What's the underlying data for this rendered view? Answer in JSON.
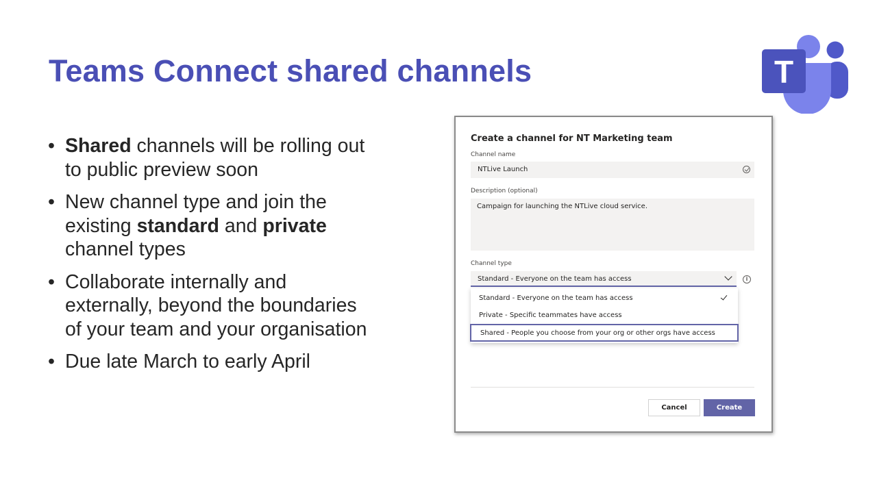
{
  "slide": {
    "title": "Teams Connect shared channels",
    "bullets": [
      {
        "bold": "Shared",
        "text": " channels will be rolling out to public preview soon"
      },
      {
        "pre": "New channel type and join the existing ",
        "bold1": "standard",
        "mid": " and ",
        "bold2": "private",
        "post": " channel types"
      },
      {
        "text": "Collaborate internally and externally, beyond the boundaries of your team and your organisation"
      },
      {
        "text": "Due late March to early April"
      }
    ]
  },
  "logo": {
    "icon": "microsoft-teams-logo",
    "letter": "T",
    "colors": {
      "tile": "#4b53bc",
      "person_front": "#7b83eb",
      "person_back": "#5059c9"
    }
  },
  "dialog": {
    "title": "Create a channel for NT Marketing team",
    "channel_name_label": "Channel name",
    "channel_name_value": "NTLive Launch",
    "description_label": "Description (optional)",
    "description_value": "Campaign for launching the NTLive cloud service.",
    "channel_type_label": "Channel type",
    "channel_type_selected": "Standard - Everyone on the team has access",
    "options": [
      "Standard - Everyone on the team has access",
      "Private - Specific teammates have access",
      "Shared - People you choose from your org or other orgs have access"
    ],
    "info_glyph": "i",
    "cancel_label": "Cancel",
    "create_label": "Create",
    "accent_color": "#6264a7"
  }
}
